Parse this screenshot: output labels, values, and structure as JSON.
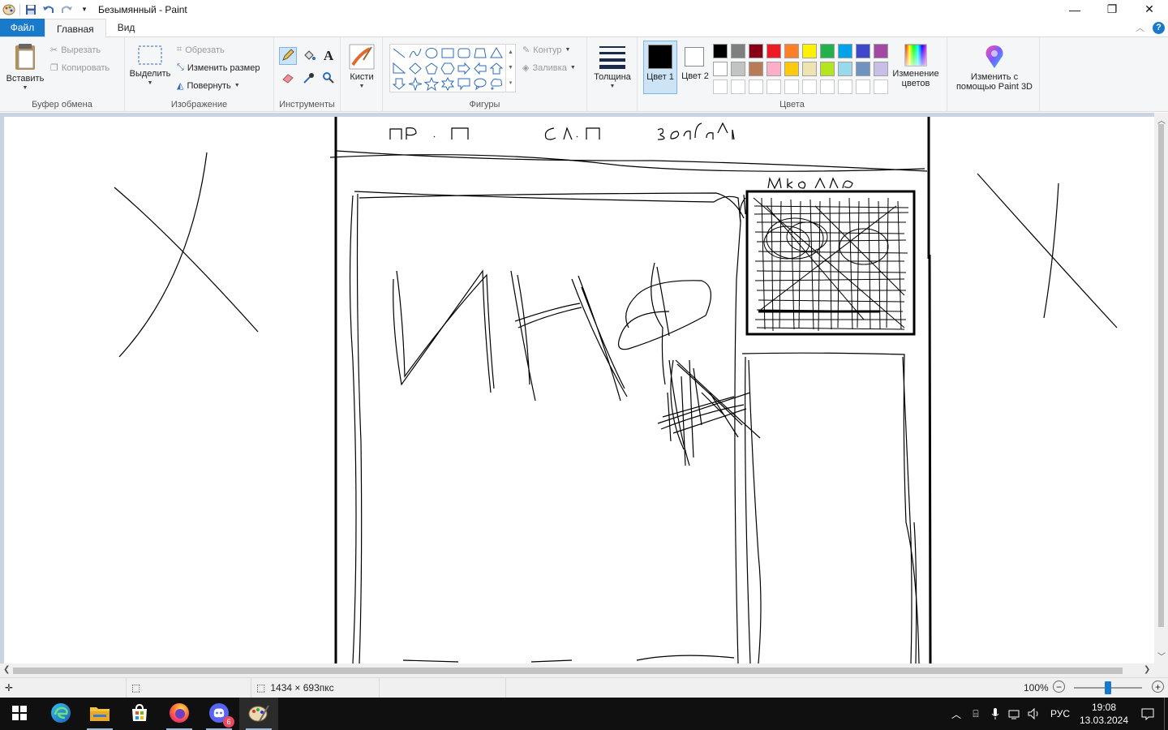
{
  "window": {
    "title": "Безымянный - Paint",
    "controls": {
      "minimize": "—",
      "maximize": "❐",
      "close": "✕"
    }
  },
  "tabs": {
    "file": "Файл",
    "home": "Главная",
    "view": "Вид"
  },
  "ribbon": {
    "clipboard": {
      "label": "Буфер обмена",
      "paste": "Вставить",
      "cut": "Вырезать",
      "copy": "Копировать"
    },
    "image": {
      "label": "Изображение",
      "select": "Выделить",
      "crop": "Обрезать",
      "resize": "Изменить размер",
      "rotate": "Повернуть"
    },
    "tools": {
      "label": "Инструменты"
    },
    "brushes": {
      "label": "Кисти"
    },
    "shapes": {
      "label": "Фигуры",
      "outline": "Контур",
      "fill": "Заливка"
    },
    "size": {
      "label": "Толщина"
    },
    "colors": {
      "label": "Цвета",
      "color1": "Цвет 1",
      "color1_value": "#000000",
      "color2": "Цвет 2",
      "color2_value": "#ffffff",
      "edit": "Изменение цветов",
      "palette": [
        "#000000",
        "#7f7f7f",
        "#880015",
        "#ed1c24",
        "#ff7f27",
        "#fff200",
        "#22b14c",
        "#00a2e8",
        "#3f48cc",
        "#a349a4",
        "#ffffff",
        "#c3c3c3",
        "#b97a57",
        "#ffaec9",
        "#ffc90e",
        "#efe4b0",
        "#b5e61d",
        "#99d9ea",
        "#7092be",
        "#c8bfe7",
        "#ffffff",
        "#ffffff",
        "#ffffff",
        "#ffffff",
        "#ffffff",
        "#ffffff",
        "#ffffff",
        "#ffffff",
        "#ffffff",
        "#ffffff"
      ]
    },
    "paint3d": {
      "label": "Изменить с помощью Paint 3D"
    }
  },
  "canvas": {
    "texts": {
      "t1": "пр . П",
      "t2": "сл.п",
      "t3": "задачи",
      "t4": "шкала",
      "t5": "ИНФА"
    }
  },
  "status": {
    "image_size": "1434 × 693пкс",
    "zoom": "100%"
  },
  "taskbar": {
    "language": "РУС",
    "time": "19:08",
    "date": "13.03.2024",
    "badge": "6"
  }
}
